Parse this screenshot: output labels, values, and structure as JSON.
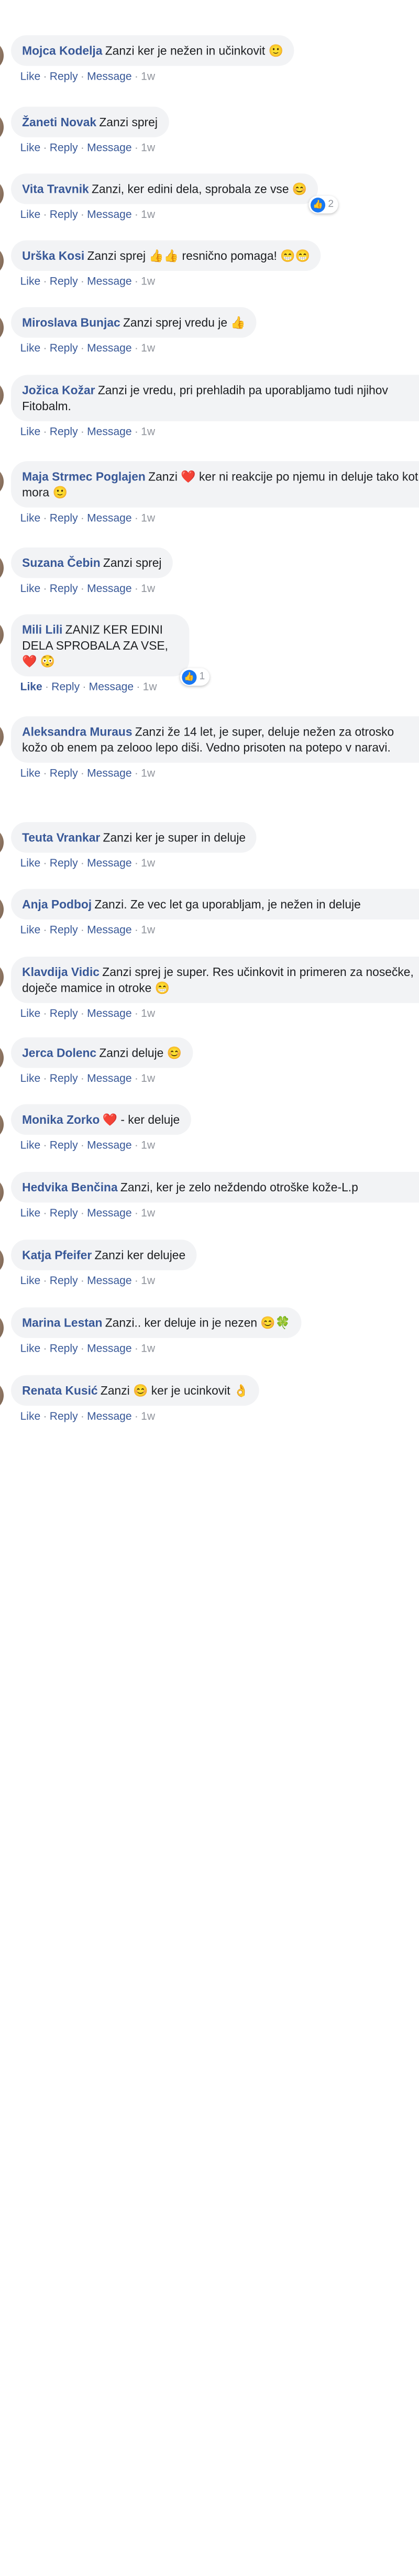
{
  "comments": [
    {
      "name": "Mojca Kodelja",
      "text": "Zanzi ker je nežen in učinkovit",
      "emoji": "🙂",
      "reactions": null
    },
    {
      "name": "Žaneti Novak",
      "text": "Zanzi sprej",
      "emoji": "",
      "reactions": null
    },
    {
      "name": "Vita Travnik",
      "text": "Zanzi, ker edini dela, sprobala ze vse",
      "emoji": "😊",
      "reactions": "2"
    },
    {
      "name": "Urška Kosi",
      "text": "Zanzi sprej 👍👍 resnično pomaga!",
      "emoji": "😁😁",
      "reactions": null
    },
    {
      "name": "Miroslava Bunjac",
      "text": "Zanzi sprej vredu je",
      "emoji": "👍",
      "reactions": null
    },
    {
      "name": "Jožica Kožar",
      "text": "Zanzi je vredu, pri prehladih pa uporabljamo tudi njihov Fitobalm.",
      "emoji": "",
      "reactions": null
    },
    {
      "name": "Maja Strmec Poglajen",
      "text": "Zanzi ❤️ ker ni reakcije po njemu in deluje tako kot mora",
      "emoji": "🙂",
      "reactions": null
    },
    {
      "name": "Suzana Čebin",
      "text": "Zanzi sprej",
      "emoji": "",
      "reactions": null
    },
    {
      "name": "Mili Lili",
      "text": "ZANIZ KER EDINI DELA SPROBALA ZA VSE, ❤️",
      "emoji": "😳",
      "reactions": "1"
    },
    {
      "name": "Aleksandra Muraus",
      "text": "Zanzi že 14 let, je super, deluje nežen za otrosko kožo ob enem pa zelooo lepo diši. Vedno prisoten na potepo v naravi.",
      "emoji": "",
      "reactions": null
    },
    {
      "name": "Teuta Vrankar",
      "text": "Zanzi ker je super in deluje",
      "emoji": "",
      "reactions": null
    },
    {
      "name": "Anja Podboj",
      "text": "Zanzi. Ze vec let ga uporabljam, je nežen in deluje",
      "emoji": "",
      "reactions": null
    },
    {
      "name": "Klavdija Vidic",
      "text": "Zanzi sprej je super. Res učinkovit in primeren za nosečke, doječe mamice in otroke",
      "emoji": "😁",
      "reactions": null
    },
    {
      "name": "Jerca Dolenc",
      "text": "Zanzi deluje",
      "emoji": "😊",
      "reactions": null
    },
    {
      "name": "Monika Zorko",
      "text": "❤️ - ker deluje",
      "emoji": "",
      "reactions": null
    },
    {
      "name": "Hedvika Benčina",
      "text": "Zanzi, ker je zelo neždendo otroške kože-L.p",
      "emoji": "",
      "reactions": null
    },
    {
      "name": "Katja Pfeifer",
      "text": "Zanzi ker delujee",
      "emoji": "",
      "reactions": null
    },
    {
      "name": "Marina Lestan",
      "text": "Zanzi.. ker deluje in je nezen",
      "emoji": "😊🍀",
      "reactions": null
    },
    {
      "name": "Renata Kusić",
      "text": "Zanzi 😊 ker je ucinkovit",
      "emoji": "👌",
      "reactions": null
    }
  ],
  "actions": {
    "like": "Like",
    "reply": "Reply",
    "message": "Message",
    "time": "1w"
  }
}
